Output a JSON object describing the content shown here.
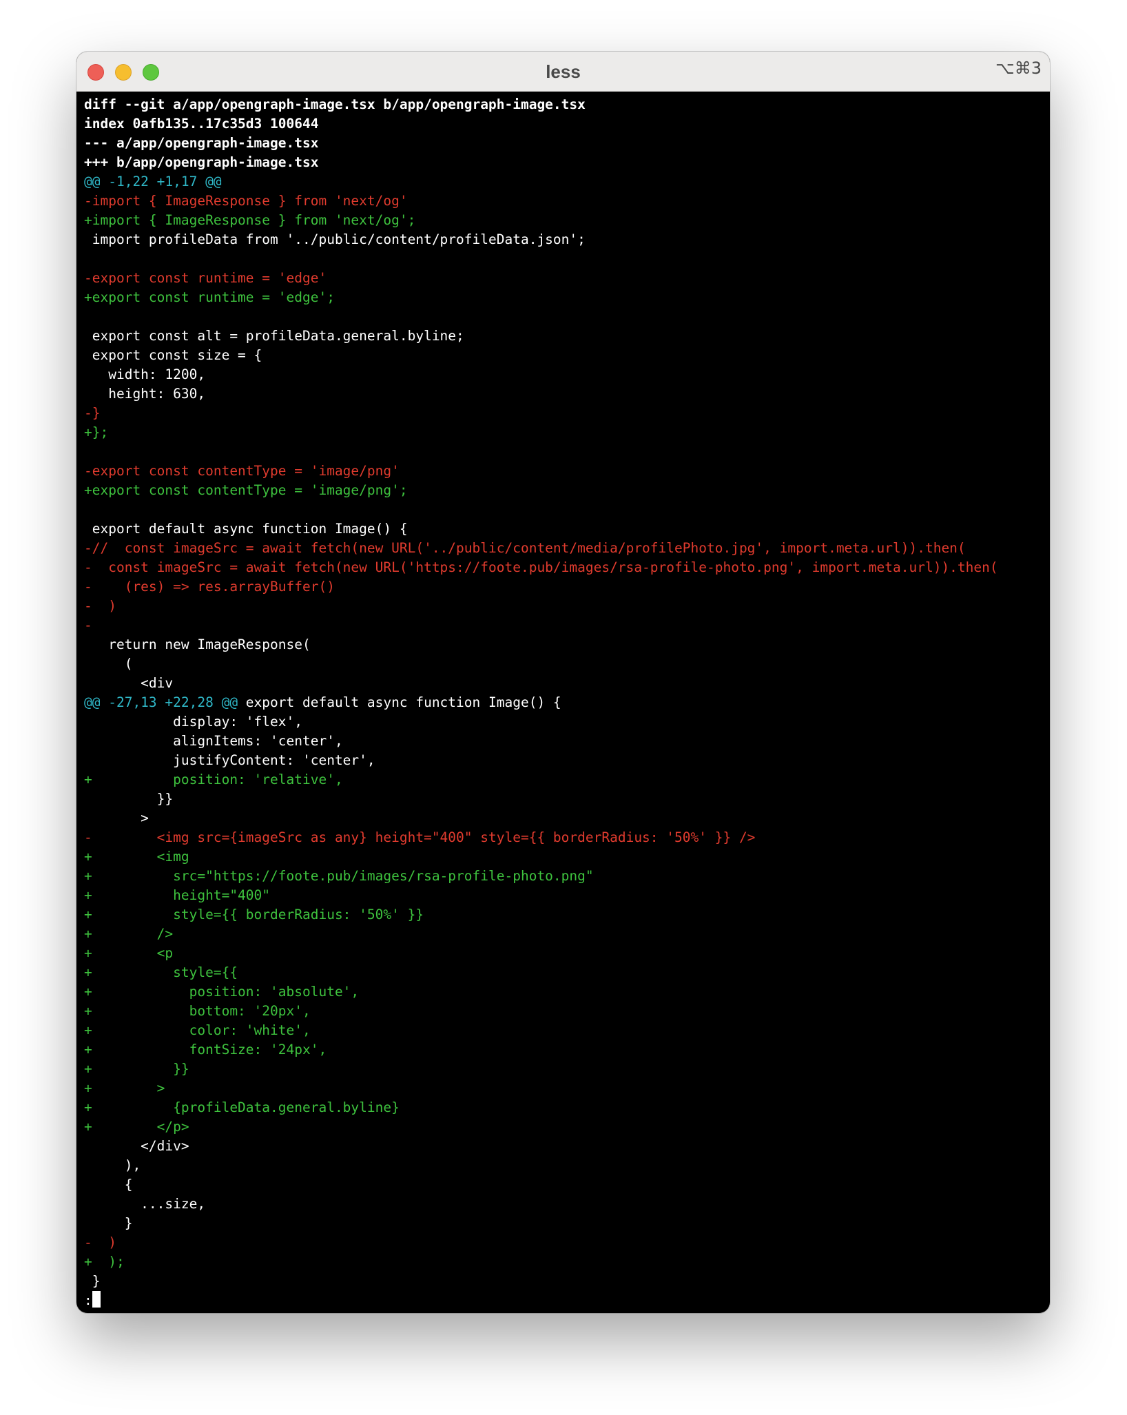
{
  "window": {
    "title": "less",
    "shortcut": "⌥⌘3"
  },
  "lines": [
    {
      "type": "meta",
      "text": "diff --git a/app/opengraph-image.tsx b/app/opengraph-image.tsx"
    },
    {
      "type": "meta",
      "text": "index 0afb135..17c35d3 100644"
    },
    {
      "type": "meta",
      "text": "--- a/app/opengraph-image.tsx"
    },
    {
      "type": "meta",
      "text": "+++ b/app/opengraph-image.tsx"
    },
    {
      "type": "hunk",
      "text": "@@ -1,22 +1,17 @@",
      "context": ""
    },
    {
      "type": "del",
      "text": "-import { ImageResponse } from 'next/og'"
    },
    {
      "type": "add",
      "text": "+import { ImageResponse } from 'next/og';"
    },
    {
      "type": "ctx",
      "text": " import profileData from '../public/content/profileData.json';"
    },
    {
      "type": "ctx",
      "text": ""
    },
    {
      "type": "del",
      "text": "-export const runtime = 'edge'"
    },
    {
      "type": "add",
      "text": "+export const runtime = 'edge';"
    },
    {
      "type": "ctx",
      "text": ""
    },
    {
      "type": "ctx",
      "text": " export const alt = profileData.general.byline;"
    },
    {
      "type": "ctx",
      "text": " export const size = {"
    },
    {
      "type": "ctx",
      "text": "   width: 1200,"
    },
    {
      "type": "ctx",
      "text": "   height: 630,"
    },
    {
      "type": "del",
      "text": "-}"
    },
    {
      "type": "add",
      "text": "+};"
    },
    {
      "type": "ctx",
      "text": ""
    },
    {
      "type": "del",
      "text": "-export const contentType = 'image/png'"
    },
    {
      "type": "add",
      "text": "+export const contentType = 'image/png';"
    },
    {
      "type": "ctx",
      "text": ""
    },
    {
      "type": "ctx",
      "text": " export default async function Image() {"
    },
    {
      "type": "del",
      "text": "-//  const imageSrc = await fetch(new URL('../public/content/media/profilePhoto.jpg', import.meta.url)).then("
    },
    {
      "type": "del",
      "text": "-  const imageSrc = await fetch(new URL('https://foote.pub/images/rsa-profile-photo.png', import.meta.url)).then("
    },
    {
      "type": "del",
      "text": "-    (res) => res.arrayBuffer()"
    },
    {
      "type": "del",
      "text": "-  )"
    },
    {
      "type": "del",
      "text": "-"
    },
    {
      "type": "ctx",
      "text": "   return new ImageResponse("
    },
    {
      "type": "ctx",
      "text": "     ("
    },
    {
      "type": "ctx",
      "text": "       <div"
    },
    {
      "type": "hunk",
      "text": "@@ -27,13 +22,28 @@",
      "context": " export default async function Image() {"
    },
    {
      "type": "ctx",
      "text": "           display: 'flex',"
    },
    {
      "type": "ctx",
      "text": "           alignItems: 'center',"
    },
    {
      "type": "ctx",
      "text": "           justifyContent: 'center',"
    },
    {
      "type": "add",
      "text": "+          position: 'relative',"
    },
    {
      "type": "ctx",
      "text": "         }}"
    },
    {
      "type": "ctx",
      "text": "       >"
    },
    {
      "type": "del",
      "text": "-        <img src={imageSrc as any} height=\"400\" style={{ borderRadius: '50%' }} />"
    },
    {
      "type": "add",
      "text": "+        <img"
    },
    {
      "type": "add",
      "text": "+          src=\"https://foote.pub/images/rsa-profile-photo.png\""
    },
    {
      "type": "add",
      "text": "+          height=\"400\""
    },
    {
      "type": "add",
      "text": "+          style={{ borderRadius: '50%' }}"
    },
    {
      "type": "add",
      "text": "+        />"
    },
    {
      "type": "add",
      "text": "+        <p"
    },
    {
      "type": "add",
      "text": "+          style={{"
    },
    {
      "type": "add",
      "text": "+            position: 'absolute',"
    },
    {
      "type": "add",
      "text": "+            bottom: '20px',"
    },
    {
      "type": "add",
      "text": "+            color: 'white',"
    },
    {
      "type": "add",
      "text": "+            fontSize: '24px',"
    },
    {
      "type": "add",
      "text": "+          }}"
    },
    {
      "type": "add",
      "text": "+        >"
    },
    {
      "type": "add",
      "text": "+          {profileData.general.byline}"
    },
    {
      "type": "add",
      "text": "+        </p>"
    },
    {
      "type": "ctx",
      "text": "       </div>"
    },
    {
      "type": "ctx",
      "text": "     ),"
    },
    {
      "type": "ctx",
      "text": "     {"
    },
    {
      "type": "ctx",
      "text": "       ...size,"
    },
    {
      "type": "ctx",
      "text": "     }"
    },
    {
      "type": "del",
      "text": "-  )"
    },
    {
      "type": "add",
      "text": "+  );"
    },
    {
      "type": "ctx",
      "text": " }"
    }
  ],
  "prompt": {
    "text": ":"
  }
}
